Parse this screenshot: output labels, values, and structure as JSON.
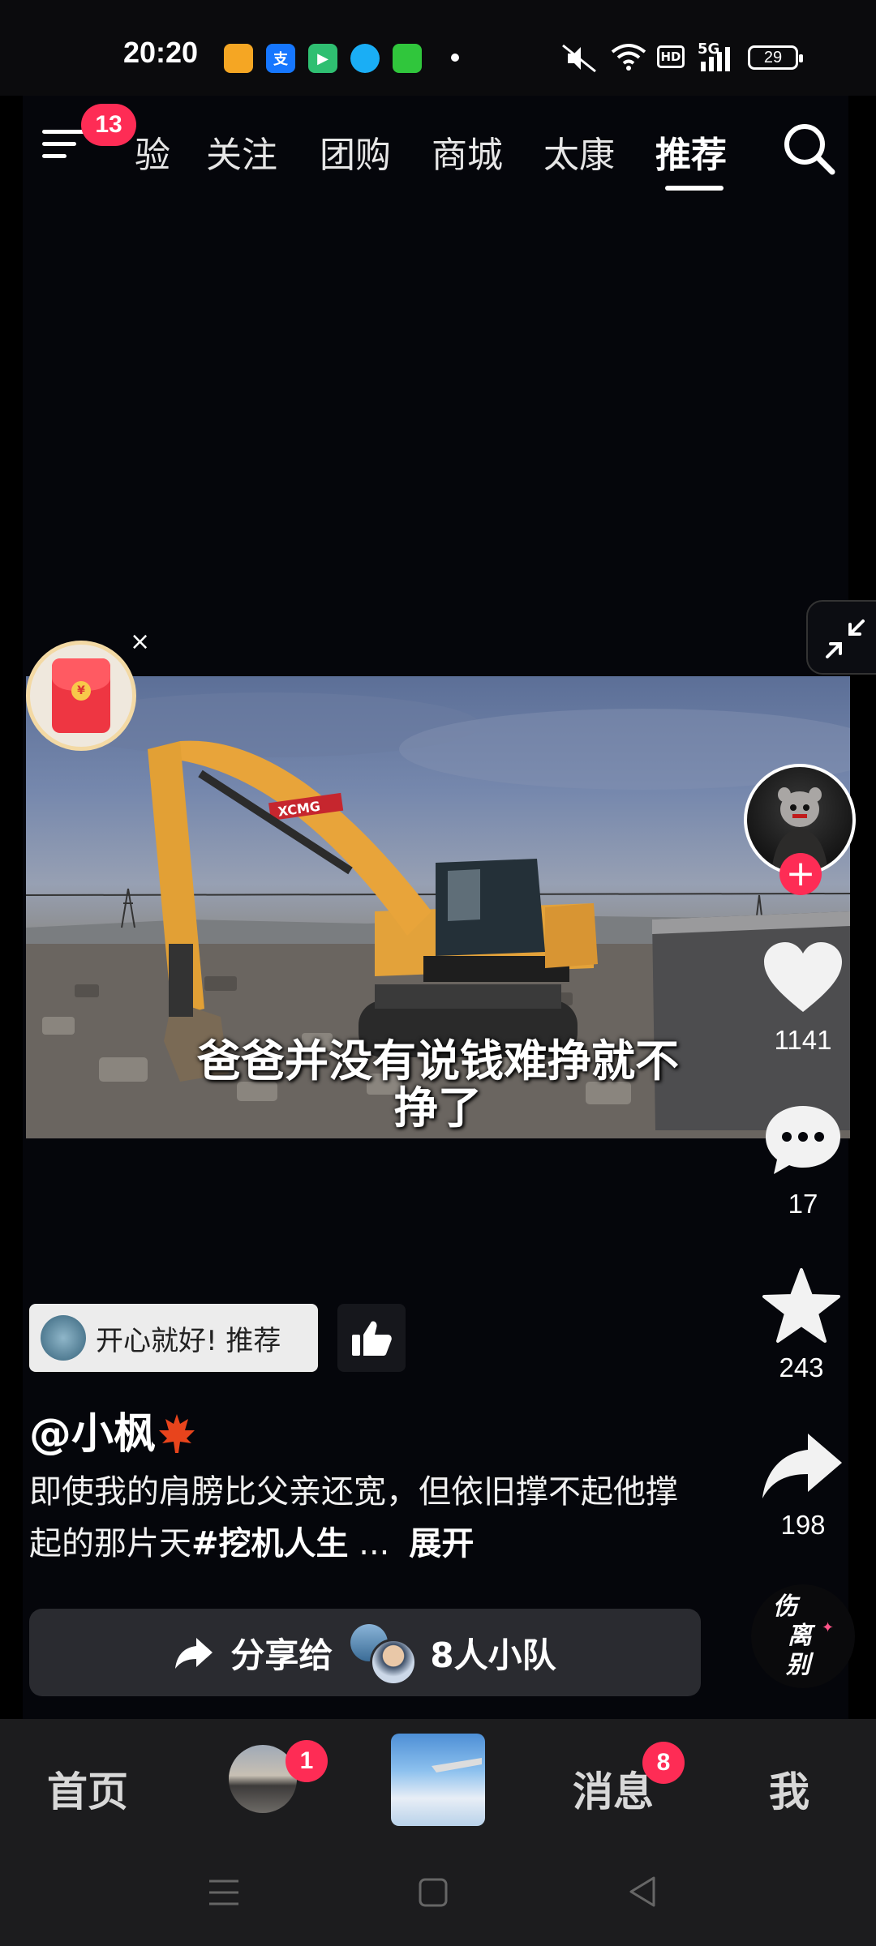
{
  "status_bar": {
    "time": "20:20",
    "app_icons": [
      {
        "name": "imou-app-icon",
        "label": "imou",
        "color": "#f5a623"
      },
      {
        "name": "alipay-app-icon",
        "label": "支",
        "color": "#1677ff"
      },
      {
        "name": "video-app-icon",
        "label": "▶",
        "color": "#2fbf71"
      },
      {
        "name": "qq-app-icon",
        "label": "●",
        "color": "#1aaef5"
      },
      {
        "name": "iqiyi-app-icon",
        "label": "iQ",
        "color": "#30c63c"
      }
    ],
    "network": "5G",
    "hd": "HD",
    "battery": "29"
  },
  "top_nav": {
    "menu_badge": "13",
    "tabs": [
      "验",
      "关注",
      "团购",
      "商城",
      "太康",
      "推荐"
    ],
    "active_tab": "推荐"
  },
  "video": {
    "subtitle_line1": "爸爸并没有说钱难挣就不",
    "subtitle_line2": "挣了",
    "machine_brand": "XCMG"
  },
  "red_packet": {
    "close": "×",
    "coin": "¥"
  },
  "actions": {
    "likes": "1141",
    "comments": "17",
    "favorites": "243",
    "shares": "198"
  },
  "recommendation": {
    "text": "开心就好! 推荐"
  },
  "post": {
    "author": "@小枫",
    "description": "即使我的肩膀比父亲还宽，但依旧撑不起他撑起的那片天",
    "hashtag": "#挖机人生",
    "ellipsis": "...",
    "expand": "展开"
  },
  "share": {
    "label": "分享给",
    "team": "8人小队"
  },
  "music_disc": {
    "text_line1": "伤",
    "text_line2": "离",
    "text_line3": "别"
  },
  "bottom_nav": {
    "home": "首页",
    "friends_badge": "1",
    "messages": "消息",
    "messages_badge": "8",
    "me": "我"
  }
}
